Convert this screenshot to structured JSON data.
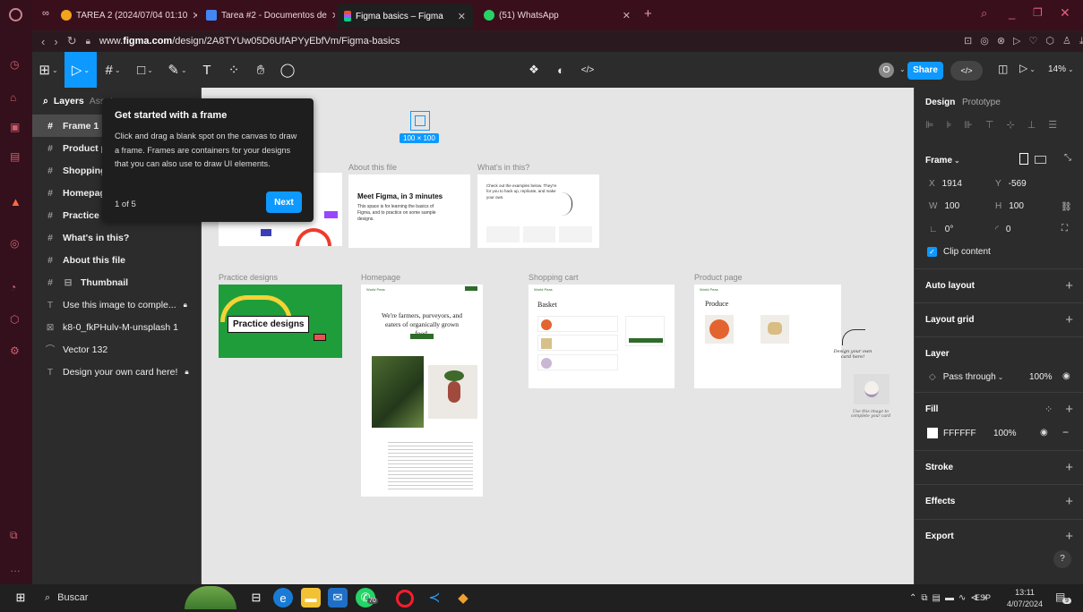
{
  "browser": {
    "tabs": [
      {
        "label": "TAREA 2 (2024/07/04 01:10",
        "color": "#f2a41b"
      },
      {
        "label": "Tarea #2 - Documentos de",
        "color": "#4285f4"
      },
      {
        "label": "Figma basics – Figma",
        "color": "#f24e1e",
        "active": true
      },
      {
        "label": "(51) WhatsApp",
        "color": "#25d366"
      }
    ],
    "url_prefix": "www.",
    "url_domain": "figma.com",
    "url_path": "/design/2A8TYUw05D6UfAPYyEbfVm/Figma-basics"
  },
  "toolbar": {
    "avatar_letter": "O",
    "share_label": "Share",
    "code_label": "</>",
    "zoom_label": "14%"
  },
  "left_panel": {
    "search_label": "Layers",
    "assets_tab": "Assets",
    "layers": [
      {
        "label": "Frame 1",
        "icon": "#",
        "bold": true,
        "selected": true
      },
      {
        "label": "Product page",
        "icon": "#",
        "bold": true
      },
      {
        "label": "Shopping cart",
        "icon": "#",
        "bold": true
      },
      {
        "label": "Homepage",
        "icon": "#",
        "bold": true
      },
      {
        "label": "Practice designs",
        "icon": "#",
        "bold": true
      },
      {
        "label": "What's in this?",
        "icon": "#",
        "bold": true
      },
      {
        "label": "About this file",
        "icon": "#",
        "bold": true
      },
      {
        "label": "Thumbnail",
        "icon": "#",
        "bold": true
      },
      {
        "label": "Use this image to comple...",
        "icon": "T",
        "locked": true
      },
      {
        "label": "k8-0_fkPHulv-M-unsplash 1",
        "icon": "img"
      },
      {
        "label": "Vector 132",
        "icon": "vec"
      },
      {
        "label": "Design your own card here!",
        "icon": "T",
        "locked": true
      }
    ]
  },
  "tooltip": {
    "title": "Get started with a frame",
    "body": "Click and drag a blank spot on the canvas to draw a frame. Frames are containers for your designs that you can also use to draw UI elements.",
    "step": "1 of 5",
    "next_label": "Next"
  },
  "canvas": {
    "size_badge": "100 × 100",
    "frames": {
      "about_label": "About this file",
      "about_title": "Meet Figma, in 3 minutes",
      "about_body": "This space is for learning the basics of Figma, and to practice on some sample designs.",
      "whats_label": "What's in this?",
      "whats_body": "Check out the examples below. They're for you to hack up, replicate, and make your own.",
      "practice_label": "Practice designs",
      "practice_title": "Practice designs",
      "homepage_label": "Homepage",
      "homepage_headline": "We're farmers, purveyors, and eaters of organically grown food.",
      "cart_label": "Shopping cart",
      "cart_title": "Basket",
      "product_label": "Product page",
      "product_title": "Produce",
      "brand": "World Peas",
      "handwrite_1": "Design your own card here!",
      "handwrite_2": "Use this image to complete your card"
    }
  },
  "right_panel": {
    "tab_design": "Design",
    "tab_prototype": "Prototype",
    "frame_label": "Frame",
    "x_label": "X",
    "x_value": "1914",
    "y_label": "Y",
    "y_value": "-569",
    "w_label": "W",
    "w_value": "100",
    "h_label": "H",
    "h_value": "100",
    "rotation": "0°",
    "radius": "0",
    "clip_label": "Clip content",
    "auto_layout": "Auto layout",
    "layout_grid": "Layout grid",
    "layer": "Layer",
    "blend": "Pass through",
    "opacity": "100%",
    "fill": "Fill",
    "fill_hex": "FFFFFF",
    "fill_opacity": "100%",
    "stroke": "Stroke",
    "effects": "Effects",
    "export": "Export",
    "help": "?"
  },
  "taskbar": {
    "search_label": "Buscar",
    "lang": "ESP",
    "time": "13:11",
    "date": "4/07/2024",
    "whatsapp_badge": "70",
    "notif_badge": "9"
  },
  "colors": {
    "accent": "#0d99ff",
    "practice_green": "#1f9d3a",
    "homepage_green": "#2f6b2a"
  }
}
